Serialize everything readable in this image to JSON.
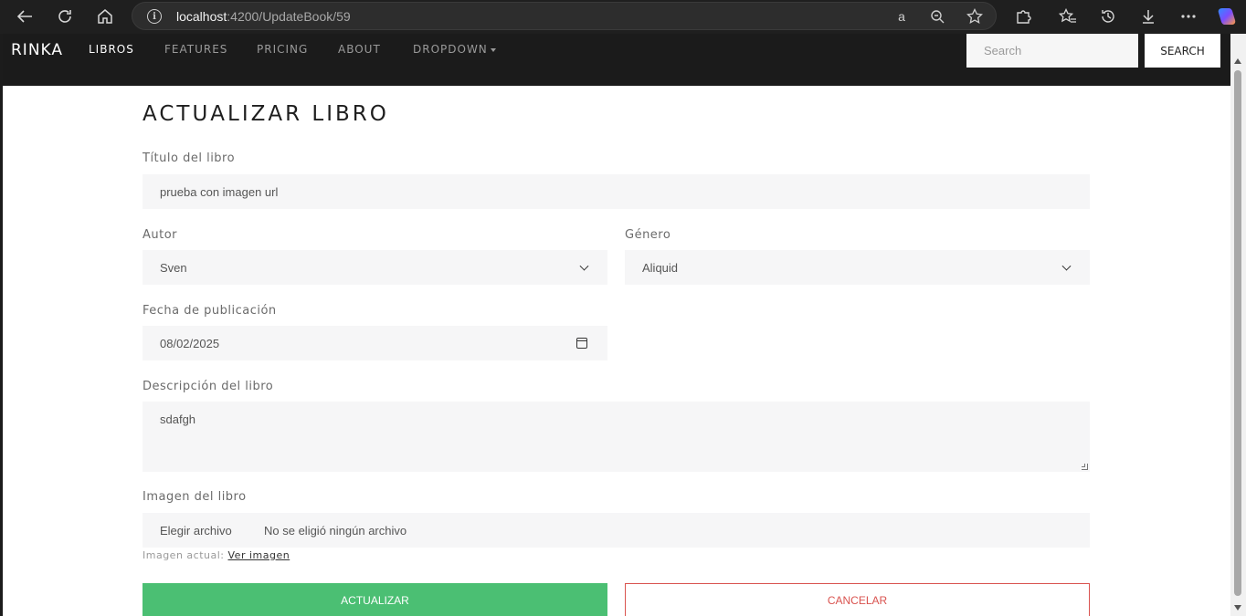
{
  "browser": {
    "url_host": "localhost",
    "url_path": ":4200/UpdateBook/59",
    "icons": [
      "back-icon",
      "reload-icon",
      "home-icon",
      "site-info-icon",
      "read-aloud-icon",
      "zoom-icon",
      "favorite-star-icon",
      "extensions-icon",
      "favorites-icon",
      "history-icon",
      "downloads-icon",
      "more-icon",
      "copilot-icon"
    ]
  },
  "navbar": {
    "brand": "RINKA",
    "links": [
      "LIBROS",
      "FEATURES",
      "PRICING",
      "ABOUT",
      "DROPDOWN"
    ],
    "active": "LIBROS",
    "search_placeholder": "Search",
    "search_button": "SEARCH"
  },
  "form": {
    "title": "ACTUALIZAR LIBRO",
    "book_title_label": "Título del libro",
    "book_title_value": "prueba con imagen url",
    "author_label": "Autor",
    "author_value": "Sven",
    "genre_label": "Género",
    "genre_value": "Aliquid",
    "date_label": "Fecha de publicación",
    "date_value": "08/02/2025",
    "description_label": "Descripción del libro",
    "description_value": "sdafgh",
    "image_label": "Imagen del libro",
    "file_button": "Elegir archivo",
    "file_status": "No se eligió ningún archivo",
    "current_image_text": "Imagen actual:",
    "current_image_link": "Ver imagen",
    "update_button": "ACTUALIZAR",
    "cancel_button": "CANCELAR"
  },
  "colors": {
    "navbar_bg": "#1b1b1b",
    "update_button": "#4bbf73",
    "cancel_button": "#d9534f",
    "field_bg": "#f6f6f7"
  }
}
